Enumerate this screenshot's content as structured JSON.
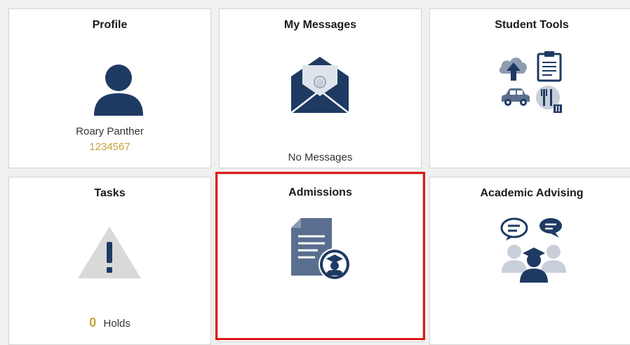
{
  "colors": {
    "navy": "#1e3a63",
    "slate": "#5a6f8f",
    "gold": "#c8a135",
    "warning_gray": "#d9d9d9",
    "highlight_red": "#e3151a"
  },
  "tiles": {
    "profile": {
      "title": "Profile",
      "icon": "user-avatar-icon",
      "name": "Roary Panther",
      "student_id": "1234567"
    },
    "messages": {
      "title": "My Messages",
      "icon": "envelope-icon",
      "status": "No Messages"
    },
    "student_tools": {
      "title": "Student Tools",
      "icons": [
        "cloud-upload-icon",
        "clipboard-icon",
        "car-icon",
        "dining-icon"
      ]
    },
    "tasks": {
      "title": "Tasks",
      "icon": "warning-icon",
      "holds_count": "0",
      "holds_label": "Holds"
    },
    "admissions": {
      "title": "Admissions",
      "icon": "admissions-document-icon",
      "selected": true
    },
    "academic_advising": {
      "title": "Academic Advising",
      "icon": "advising-chat-icon"
    }
  }
}
